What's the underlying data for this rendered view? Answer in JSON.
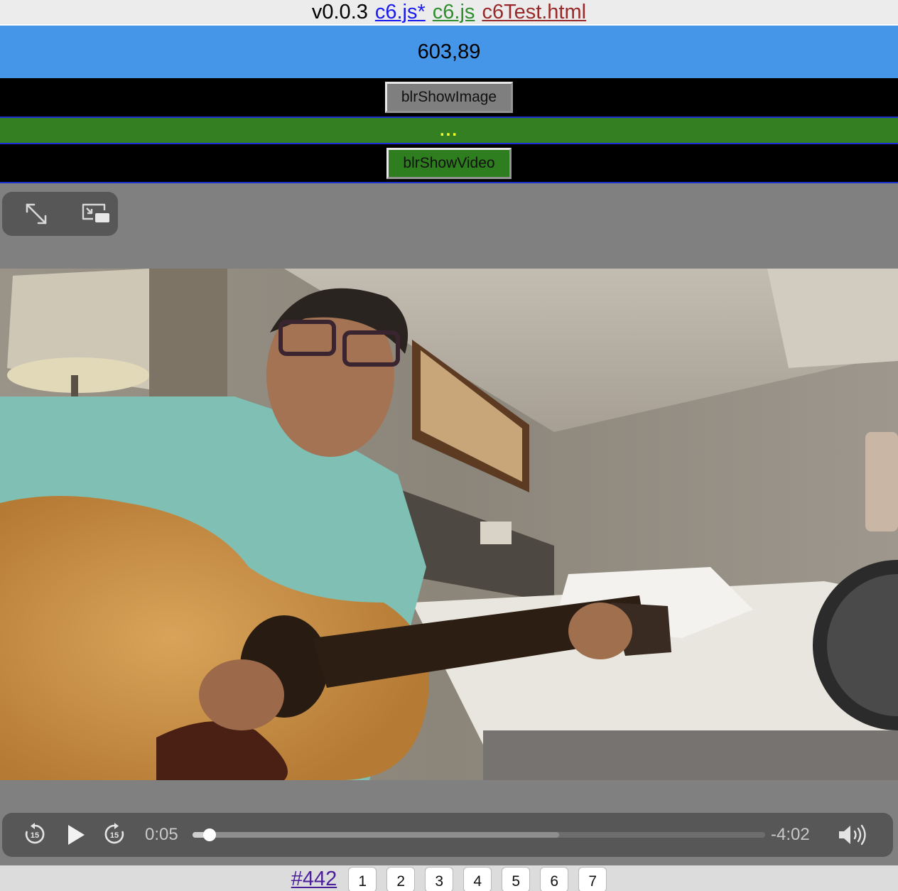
{
  "header": {
    "version": "v0.0.3",
    "links": [
      "c6.js*",
      "c6.js",
      "c6Test.html"
    ]
  },
  "coords_display": "603,89",
  "buttons": {
    "show_image": "blrShowImage",
    "show_video": "blrShowVideo"
  },
  "status_text": "...",
  "player": {
    "top_controls": [
      "fullscreen-icon",
      "picture-in-picture-icon"
    ],
    "skip_back_label": "15",
    "skip_forward_label": "15",
    "current_time": "0:05",
    "remaining_time": "-4:02",
    "progress_fraction": 0.03,
    "buffered_fraction": 0.64
  },
  "pager": {
    "item_link": "#442",
    "pages": [
      "1",
      "2",
      "3",
      "4",
      "5",
      "6",
      "7"
    ]
  },
  "colors": {
    "coords_bg": "#4596e8",
    "status_bg": "#347f21",
    "status_text": "#f4ff2a",
    "link_blue": "#1a1aee",
    "link_green": "#2f8f2f",
    "link_red": "#9a2a2a"
  }
}
